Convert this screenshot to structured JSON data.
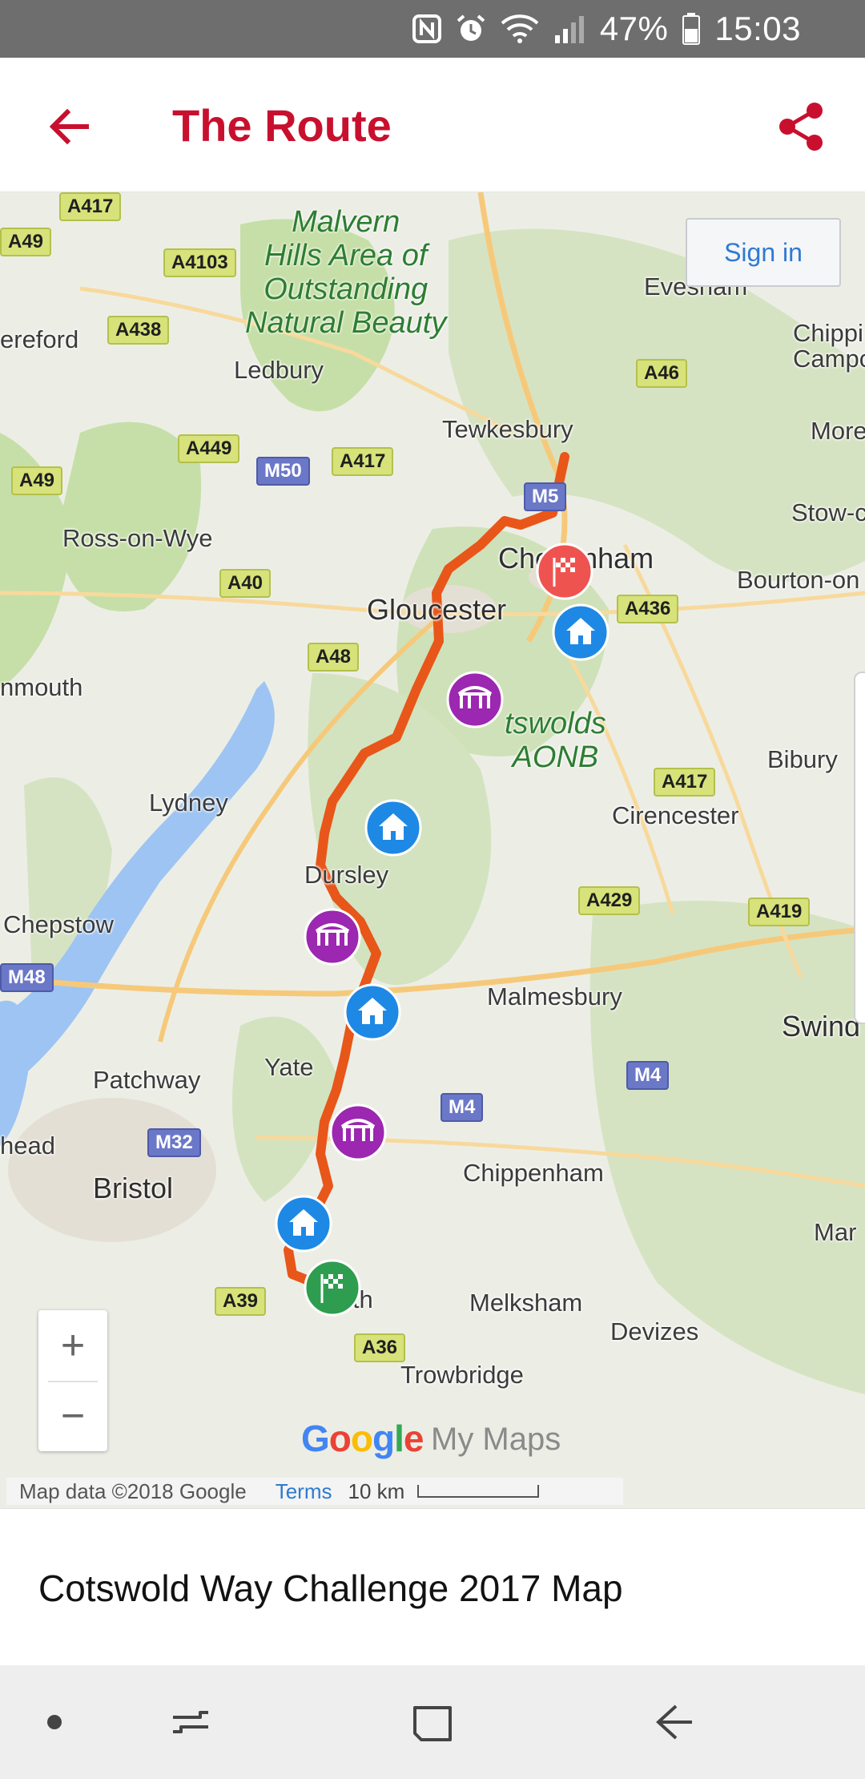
{
  "status_bar": {
    "battery": "47%",
    "time": "15:03",
    "icons": [
      "nfc-icon",
      "alarm-icon",
      "wifi-icon",
      "signal-icon",
      "battery-icon"
    ]
  },
  "app_bar": {
    "title": "The Route",
    "back_icon": "arrow-back-icon",
    "share_icon": "share-icon"
  },
  "map": {
    "sign_in": "Sign in",
    "places": {
      "malvern": "Malvern\nHills Area of\nOutstanding\nNatural Beauty",
      "evesham": "Evesham",
      "hereford": "ereford",
      "ledbury": "Ledbury",
      "chipping": "Chippi\nCampc",
      "tewkesbury": "Tewkesbury",
      "more": "More",
      "stow": "Stow-c",
      "ross": "Ross-on-Wye",
      "cheltenham": "Cheltenham",
      "bourton": "Bourton-on",
      "gloucester": "Gloucester",
      "monmouth": "nmouth",
      "cotswolds": "tswolds\nAONB",
      "bibury": "Bibury",
      "lydney": "Lydney",
      "cirencester": "Cirencester",
      "dursley": "Dursley",
      "chepstow": "Chepstow",
      "malmesbury": "Malmesbury",
      "swindon": "Swind",
      "yate": "Yate",
      "patchway": "Patchway",
      "head": "head",
      "bristol": "Bristol",
      "chippenham": "Chippenham",
      "marlborough": "Mar",
      "bath": "Bath",
      "melksham": "Melksham",
      "devizes": "Devizes",
      "trowbridge": "Trowbridge"
    },
    "roads": {
      "a417_top": "A417",
      "a49_left": "A49",
      "a4103": "A4103",
      "a438": "A438",
      "a46": "A46",
      "a449": "A449",
      "m50": "M50",
      "a417_mid": "A417",
      "a49_low": "A49",
      "m5": "M5",
      "a40": "A40",
      "a436": "A436",
      "a48": "A48",
      "a417_right": "A417",
      "a429": "A429",
      "a419": "A419",
      "m48": "M48",
      "m4_right": "M4",
      "m4_mid": "M4",
      "m32": "M32",
      "a39": "A39",
      "a36": "A36"
    },
    "markers": [
      {
        "type": "finish",
        "icon": "checkered-flag-icon",
        "color": "#ef5350"
      },
      {
        "type": "rest-stop",
        "icon": "home-icon",
        "color": "#1e88e5"
      },
      {
        "type": "pit-stop",
        "icon": "tent-icon",
        "color": "#9c27b0"
      },
      {
        "type": "rest-stop",
        "icon": "home-icon",
        "color": "#1e88e5"
      },
      {
        "type": "pit-stop",
        "icon": "tent-icon",
        "color": "#9c27b0"
      },
      {
        "type": "rest-stop",
        "icon": "home-icon",
        "color": "#1e88e5"
      },
      {
        "type": "pit-stop",
        "icon": "tent-icon",
        "color": "#9c27b0"
      },
      {
        "type": "rest-stop",
        "icon": "home-icon",
        "color": "#1e88e5"
      },
      {
        "type": "start",
        "icon": "checkered-flag-icon",
        "color": "#2e9d4f"
      }
    ],
    "route_color": "#e8561a",
    "zoom_in": "+",
    "zoom_out": "−",
    "google": "Google",
    "my_maps": "My Maps",
    "attribution": "Map data ©2018 Google",
    "terms": "Terms",
    "scale": "10 km"
  },
  "map_title": "Cotswold Way Challenge 2017 Map",
  "nav_bar": {
    "icons": [
      "dot-icon",
      "recent-apps-icon",
      "home-square-icon",
      "back-nav-icon"
    ]
  }
}
